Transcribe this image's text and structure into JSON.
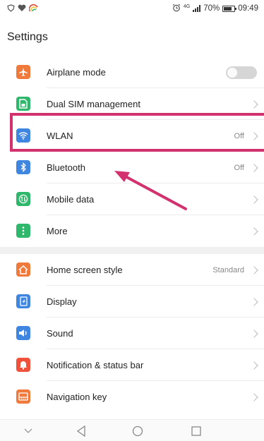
{
  "status_bar": {
    "time": "09:49",
    "battery": "70%",
    "network": "4G",
    "icons_left": [
      "shield-icon",
      "heart-icon",
      "rainbow-icon"
    ],
    "icons_right": [
      "alarm-icon",
      "signal-icon",
      "battery-icon"
    ]
  },
  "page": {
    "title": "Settings"
  },
  "settings_group_1": [
    {
      "id": "airplane",
      "label": "Airplane mode",
      "icon": "airplane-icon",
      "color": "#f07a3b",
      "toggle": false
    },
    {
      "id": "dual-sim",
      "label": "Dual SIM management",
      "icon": "sim-card-icon",
      "color": "#2fb86c"
    },
    {
      "id": "wlan",
      "label": "WLAN",
      "value": "Off",
      "icon": "wifi-icon",
      "color": "#3f86e0"
    },
    {
      "id": "bluetooth",
      "label": "Bluetooth",
      "value": "Off",
      "icon": "bluetooth-icon",
      "color": "#3f86e0"
    },
    {
      "id": "mobile-data",
      "label": "Mobile data",
      "icon": "mobile-data-icon",
      "color": "#2fb86c"
    },
    {
      "id": "more",
      "label": "More",
      "icon": "more-icon",
      "color": "#2fb86c"
    }
  ],
  "settings_group_2": [
    {
      "id": "home-screen",
      "label": "Home screen style",
      "value": "Standard",
      "icon": "home-icon",
      "color": "#f07a3b"
    },
    {
      "id": "display",
      "label": "Display",
      "icon": "display-icon",
      "color": "#3f86e0"
    },
    {
      "id": "sound",
      "label": "Sound",
      "icon": "speaker-icon",
      "color": "#3f86e0"
    },
    {
      "id": "notification",
      "label": "Notification & status bar",
      "icon": "bell-icon",
      "color": "#f0513b"
    },
    {
      "id": "navigation-key",
      "label": "Navigation key",
      "icon": "navigation-key-icon",
      "color": "#f07a3b"
    }
  ],
  "annotations": {
    "highlight_color": "#d2326d",
    "arrow_color": "#d2326d"
  },
  "nav_bar": [
    "chevron-down-icon",
    "back-icon",
    "home-circle-icon",
    "recents-icon"
  ]
}
